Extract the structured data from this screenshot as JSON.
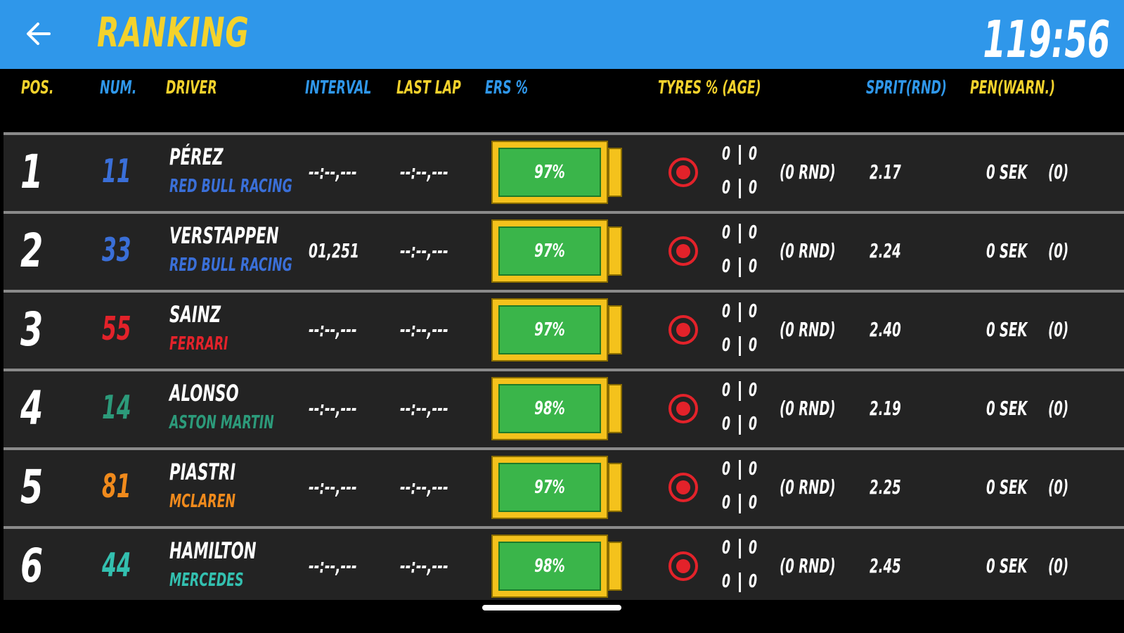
{
  "header": {
    "title": "RANKING",
    "timer": "119:56",
    "back_icon": "arrow-left-icon"
  },
  "columns": {
    "pos": "POS.",
    "num": "NUM.",
    "driver": "DRIVER",
    "interval": "INTERVAL",
    "last_lap": "LAST LAP",
    "ers": "ERS %",
    "tyres": "TYRES % (AGE)",
    "sprit": "SPRIT(RND)",
    "pen": "PEN(WARN.)"
  },
  "colors": {
    "topbar": "#2f97ea",
    "accent_yellow": "#f4d22c",
    "row_bg": "#232323",
    "ers_fill": "#3ab54a",
    "tyre_red": "#e3222a"
  },
  "rows": [
    {
      "pos": "1",
      "num": "11",
      "num_color": "#3a6fd8",
      "driver": "PÉREZ",
      "team": "RED BULL RACING",
      "team_color": "#3a6fd8",
      "interval": "--:--,---",
      "last_lap": "--:--,---",
      "ers": "97%",
      "tyre_top_left": "0",
      "tyre_top_right": "0",
      "tyre_bottom_left": "0",
      "tyre_bottom_right": "0",
      "age": "(0 RND)",
      "sprit": "2.17",
      "pen": "0 SEK",
      "warn": "(0)"
    },
    {
      "pos": "2",
      "num": "33",
      "num_color": "#3a6fd8",
      "driver": "VERSTAPPEN",
      "team": "RED BULL RACING",
      "team_color": "#3a6fd8",
      "interval": "01,251",
      "last_lap": "--:--,---",
      "ers": "97%",
      "tyre_top_left": "0",
      "tyre_top_right": "0",
      "tyre_bottom_left": "0",
      "tyre_bottom_right": "0",
      "age": "(0 RND)",
      "sprit": "2.24",
      "pen": "0 SEK",
      "warn": "(0)"
    },
    {
      "pos": "3",
      "num": "55",
      "num_color": "#e3222a",
      "driver": "SAINZ",
      "team": "FERRARI",
      "team_color": "#e3222a",
      "interval": "--:--,---",
      "last_lap": "--:--,---",
      "ers": "97%",
      "tyre_top_left": "0",
      "tyre_top_right": "0",
      "tyre_bottom_left": "0",
      "tyre_bottom_right": "0",
      "age": "(0 RND)",
      "sprit": "2.40",
      "pen": "0 SEK",
      "warn": "(0)"
    },
    {
      "pos": "4",
      "num": "14",
      "num_color": "#2c9a7a",
      "driver": "ALONSO",
      "team": "ASTON MARTIN",
      "team_color": "#2c9a7a",
      "interval": "--:--,---",
      "last_lap": "--:--,---",
      "ers": "98%",
      "tyre_top_left": "0",
      "tyre_top_right": "0",
      "tyre_bottom_left": "0",
      "tyre_bottom_right": "0",
      "age": "(0 RND)",
      "sprit": "2.19",
      "pen": "0 SEK",
      "warn": "(0)"
    },
    {
      "pos": "5",
      "num": "81",
      "num_color": "#f08a1c",
      "driver": "PIASTRI",
      "team": "MCLAREN",
      "team_color": "#f08a1c",
      "interval": "--:--,---",
      "last_lap": "--:--,---",
      "ers": "97%",
      "tyre_top_left": "0",
      "tyre_top_right": "0",
      "tyre_bottom_left": "0",
      "tyre_bottom_right": "0",
      "age": "(0 RND)",
      "sprit": "2.25",
      "pen": "0 SEK",
      "warn": "(0)"
    },
    {
      "pos": "6",
      "num": "44",
      "num_color": "#33c0b0",
      "driver": "HAMILTON",
      "team": "MERCEDES",
      "team_color": "#33c0b0",
      "interval": "--:--,---",
      "last_lap": "--:--,---",
      "ers": "98%",
      "tyre_top_left": "0",
      "tyre_top_right": "0",
      "tyre_bottom_left": "0",
      "tyre_bottom_right": "0",
      "age": "(0 RND)",
      "sprit": "2.45",
      "pen": "0 SEK",
      "warn": "(0)"
    }
  ]
}
